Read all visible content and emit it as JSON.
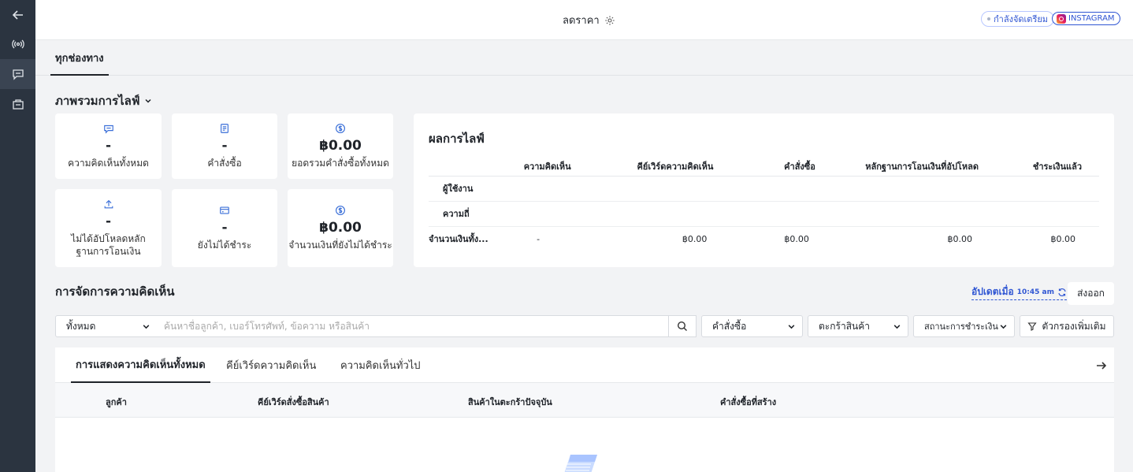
{
  "header": {
    "title": "ลดราคา",
    "status": "กำลังจัดเตรียม",
    "platform": "INSTAGRAM"
  },
  "channel_tabs": [
    "ทุกช่องทาง"
  ],
  "overview": {
    "title": "ภาพรวมการไลฟ์",
    "cards": [
      {
        "icon": "comment-icon",
        "value": "-",
        "label": "ความคิดเห็นทั้งหมด"
      },
      {
        "icon": "order-icon",
        "value": "-",
        "label": "คำสั่งซื้อ"
      },
      {
        "icon": "dollar-icon",
        "value": "฿0.00",
        "label": "ยอดรวมคำสั่งซื้อทั้งหมด"
      },
      {
        "icon": "upload-icon",
        "value": "-",
        "label": "ไม่ได้อัปโหลดหลักฐานการโอนเงิน"
      },
      {
        "icon": "card-icon",
        "value": "-",
        "label": "ยังไม่ได้ชำระ"
      },
      {
        "icon": "dollar-icon",
        "value": "฿0.00",
        "label": "จำนวนเงินที่ยังไม่ได้ชำระ"
      }
    ]
  },
  "live_results": {
    "title": "ผลการไลฟ์",
    "columns": [
      "ความคิดเห็น",
      "คีย์เวิร์ดความคิดเห็น",
      "คำสั่งซื้อ",
      "หลักฐานการโอนเงินที่อัปโหลด",
      "ชำระเงินแล้ว"
    ],
    "rows": [
      {
        "label": "ผู้ใช้งาน",
        "cells": [
          "",
          "",
          "",
          "",
          ""
        ]
      },
      {
        "label": "ความถี่",
        "cells": [
          "",
          "",
          "",
          "",
          ""
        ]
      },
      {
        "label": "จำนวนเงินทั้ง...",
        "cells": [
          "-",
          "฿0.00",
          "฿0.00",
          "฿0.00",
          "฿0.00"
        ]
      }
    ]
  },
  "comment_mgmt": {
    "title": "การจัดการความคิดเห็น",
    "update_label": "อัปเดตเมื่อ",
    "update_time": "10:45 am",
    "export_label": "ส่งออก",
    "scope_select": "ทั้งหมด",
    "search_placeholder": "ค้นหาชื่อลูกค้า, เบอร์โทรศัพท์, ข้อความ หรือสินค้า",
    "order_select": "คำสั่งซื้อ",
    "cart_select": "ตะกร้าสินค้า",
    "payment_select": "สถานะการชำระเงิน",
    "more_filters": "ตัวกรองเพิ่มเติม",
    "tabs": [
      "การแสดงความคิดเห็นทั้งหมด",
      "คีย์เวิร์ดความคิดเห็น",
      "ความคิดเห็นทั่วไป"
    ],
    "columns": [
      "ลูกค้า",
      "คีย์เวิร์ดสั่งซื้อสินค้า",
      "สินค้าในตะกร้าปัจจุบัน",
      "คำสั่งซื้อที่สร้าง"
    ]
  }
}
